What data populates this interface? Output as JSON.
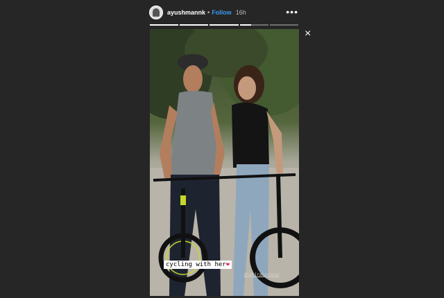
{
  "header": {
    "username": "ayushmannk",
    "separator": "•",
    "follow_label": "Follow",
    "timestamp": "16h",
    "more_icon": "more-horizontal-icon",
    "avatar_icon": "avatar-image"
  },
  "progress": {
    "segments": [
      1,
      1,
      1,
      0.4,
      0
    ],
    "active_color": "#ffffff",
    "inactive_color": "rgba(255,255,255,0.35)"
  },
  "close_label": "×",
  "story": {
    "caption": "cycling with her",
    "caption_heart": "❤",
    "mention": "@tahirakashyap",
    "follow_color": "#3897f0",
    "heart_color": "#e0245e"
  }
}
